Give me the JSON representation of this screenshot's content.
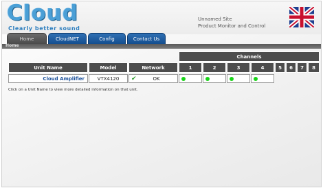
{
  "brand": {
    "name": "Cloud",
    "tagline": "Clearly better sound"
  },
  "site": {
    "name": "Unnamed Site",
    "subtitle": "Product Monitor and Control"
  },
  "tabs": [
    {
      "label": "Home",
      "active": true
    },
    {
      "label": "CloudNET",
      "active": false
    },
    {
      "label": "Config",
      "active": false
    },
    {
      "label": "Contact Us",
      "active": false
    }
  ],
  "breadcrumb": "Home",
  "table": {
    "channels_header": "Channels",
    "columns": [
      "Unit Name",
      "Model",
      "Network",
      "1",
      "2",
      "3",
      "4",
      "5",
      "6",
      "7",
      "8"
    ],
    "rows": [
      {
        "unit_name": "Cloud Amplifier",
        "model": "VTX4120",
        "network_status": "OK",
        "network_icon": "check-icon",
        "channel_status": [
          "on",
          "on",
          "on",
          "on"
        ],
        "channel_color": "#19d419"
      }
    ]
  },
  "note": "Click on a Unit Name to view more detailed information on that unit.",
  "colors": {
    "tab_blue": "#1f5fa3",
    "header_gray": "#4d4d4d",
    "link": "#1a4f9a"
  }
}
